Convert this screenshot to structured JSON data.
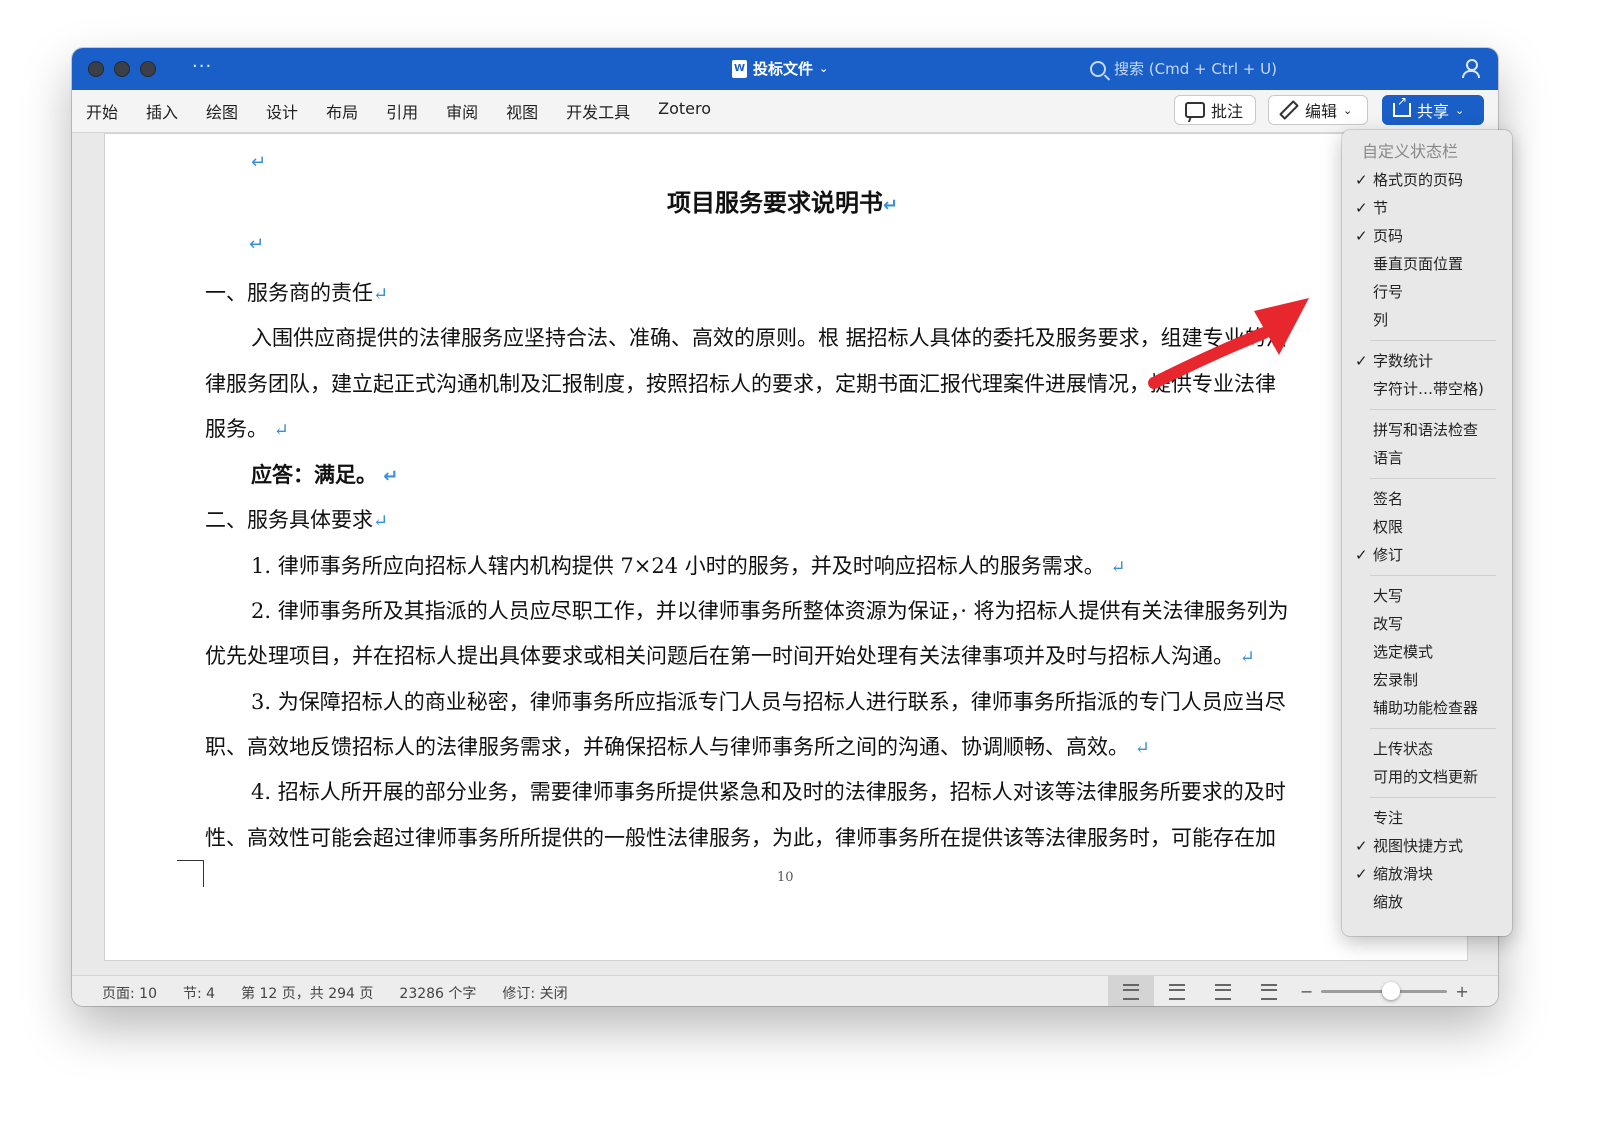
{
  "window": {
    "title": "投标文件",
    "more": "···",
    "search_placeholder": "搜索 (Cmd + Ctrl + U)"
  },
  "ribbon": {
    "tabs": [
      "开始",
      "插入",
      "绘图",
      "设计",
      "布局",
      "引用",
      "审阅",
      "视图",
      "开发工具",
      "Zotero"
    ],
    "comment_label": "批注",
    "edit_label": "编辑",
    "share_label": "共享"
  },
  "document": {
    "title": "项目服务要求说明书",
    "paragraphs": [
      "一、服务商的责任",
      "入围供应商提供的法律服务应坚持合法、准确、高效的原则。根 据招标人具体的委托及服务要求，组建专业的法",
      "律服务团队，建立起正式沟通机制及汇报制度，按照招标人的要求，定期书面汇报代理案件进展情况，提供专业法律",
      "服务。",
      "应答：满足。",
      "二、服务具体要求",
      "1. 律师事务所应向招标人辖内机构提供 7×24 小时的服务，并及时响应招标人的服务需求。",
      "2. 律师事务所及其指派的人员应尽职工作，并以律师事务所整体资源为保证，· 将为招标人提供有关法律服务列为",
      "优先处理项目，并在招标人提出具体要求或相关问题后在第一时间开始处理有关法律事项并及时与招标人沟通。",
      "3. 为保障招标人的商业秘密，律师事务所应指派专门人员与招标人进行联系，律师事务所指派的专门人员应当尽",
      "职、高效地反馈招标人的法律服务需求，并确保招标人与律师事务所之间的沟通、协调顺畅、高效。",
      "4. 招标人所开展的部分业务，需要律师事务所提供紧急和及时的法律服务，招标人对该等法律服务所要求的及时",
      "性、高效性可能会超过律师事务所所提供的一般性法律服务，为此，律师事务所在提供该等法律服务时，可能存在加"
    ],
    "page_number": "10"
  },
  "status_bar": {
    "page": "页面: 10",
    "section": "节: 4",
    "page_of": "第 12 页，共 294 页",
    "words": "23286 个字",
    "track": "修订: 关闭",
    "zoom_minus": "−",
    "zoom_plus": "+",
    "zoom_level": 0.55
  },
  "context_menu": {
    "title": "自定义状态栏",
    "groups": [
      [
        {
          "label": "格式页的页码",
          "checked": true
        },
        {
          "label": "节",
          "checked": true
        },
        {
          "label": "页码",
          "checked": true
        },
        {
          "label": "垂直页面位置",
          "checked": false
        },
        {
          "label": "行号",
          "checked": false
        },
        {
          "label": "列",
          "checked": false
        }
      ],
      [
        {
          "label": "字数统计",
          "checked": true
        },
        {
          "label": "字符计…带空格)",
          "checked": false
        }
      ],
      [
        {
          "label": "拼写和语法检查",
          "checked": false
        },
        {
          "label": "语言",
          "checked": false
        }
      ],
      [
        {
          "label": "签名",
          "checked": false
        },
        {
          "label": "权限",
          "checked": false
        },
        {
          "label": "修订",
          "checked": true
        }
      ],
      [
        {
          "label": "大写",
          "checked": false
        },
        {
          "label": "改写",
          "checked": false
        },
        {
          "label": "选定模式",
          "checked": false
        },
        {
          "label": "宏录制",
          "checked": false
        },
        {
          "label": "辅助功能检查器",
          "checked": false
        }
      ],
      [
        {
          "label": "上传状态",
          "checked": false
        },
        {
          "label": "可用的文档更新",
          "checked": false
        }
      ],
      [
        {
          "label": "专注",
          "checked": false
        },
        {
          "label": "视图快捷方式",
          "checked": true
        },
        {
          "label": "缩放滑块",
          "checked": true
        },
        {
          "label": "缩放",
          "checked": false
        }
      ]
    ]
  },
  "colors": {
    "titlebar": "#1a5fc7",
    "paragraph_mark": "#3a8fdc",
    "arrow": "#e8262e"
  },
  "icons": [
    "window-close-icon",
    "word-doc-icon",
    "search-icon",
    "person-share-icon",
    "comment-icon",
    "pencil-icon",
    "share-icon",
    "check-icon",
    "paragraph-mark-icon",
    "print-layout-icon",
    "web-layout-icon",
    "outline-icon",
    "draft-icon"
  ]
}
